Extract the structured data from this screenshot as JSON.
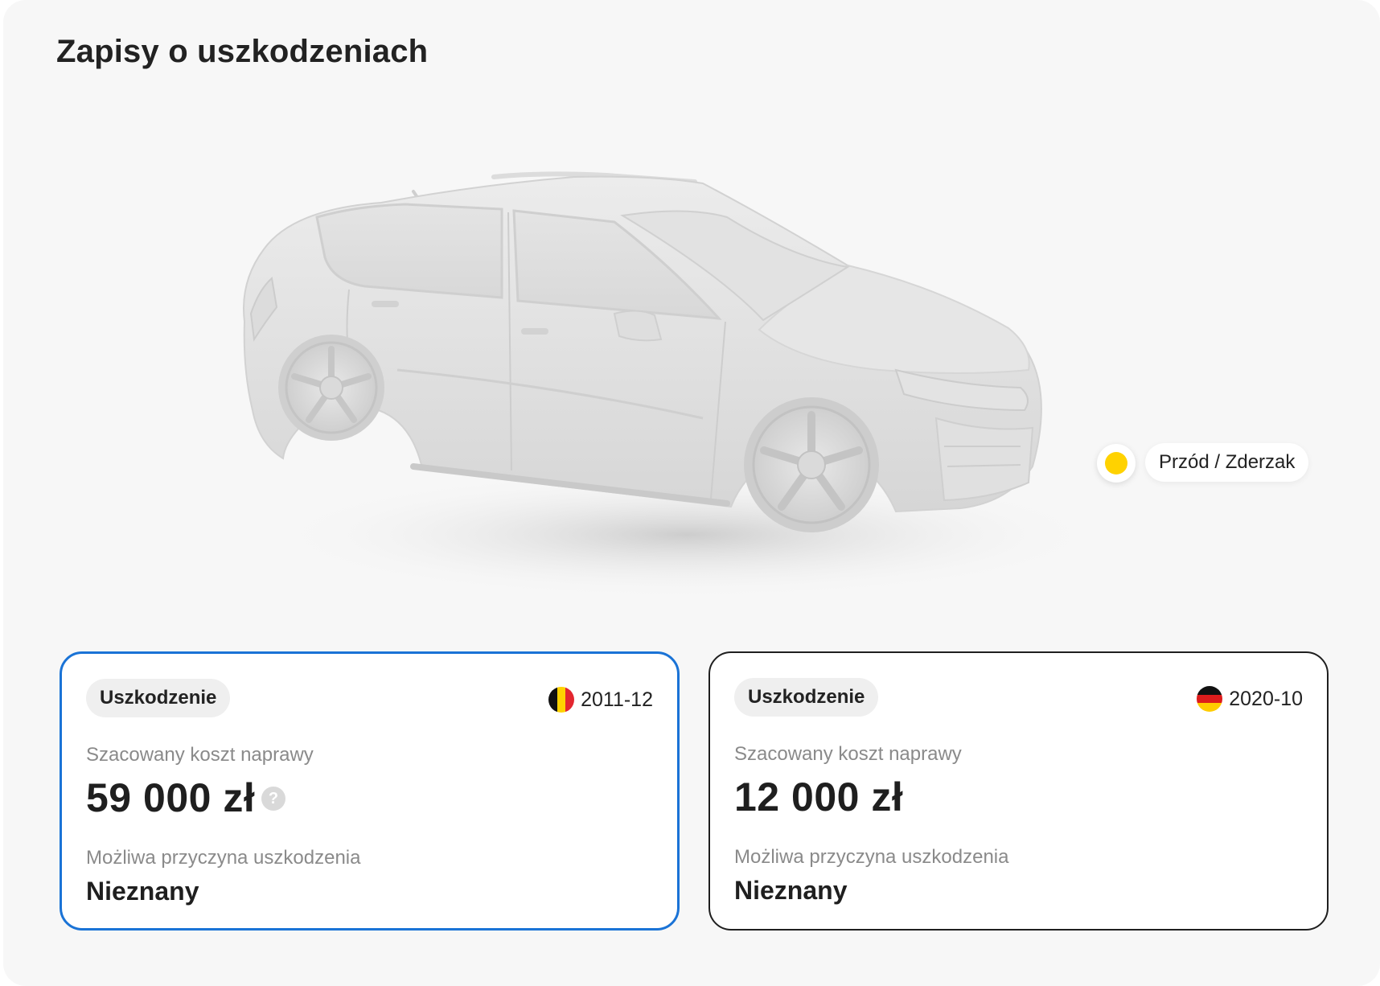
{
  "page": {
    "title": "Zapisy o uszkodzeniach"
  },
  "hotspot": {
    "label": "Przód / Zderzak",
    "color": "#ffd200"
  },
  "records": [
    {
      "badge": "Uszkodzenie",
      "flag_icon": "belgium-flag-icon",
      "date": "2011-12",
      "cost_label": "Szacowany koszt naprawy",
      "cost_value": "59 000 zł",
      "help_icon": "question-mark-icon",
      "help_symbol": "?",
      "cause_label": "Możliwa przyczyna uszkodzenia",
      "cause_value": "Nieznany",
      "selected": true
    },
    {
      "badge": "Uszkodzenie",
      "flag_icon": "germany-flag-icon",
      "date": "2020-10",
      "cost_label": "Szacowany koszt naprawy",
      "cost_value": "12 000 zł",
      "cause_label": "Możliwa przyczyna uszkodzenia",
      "cause_value": "Nieznany",
      "selected": false
    }
  ],
  "colors": {
    "selected_border": "#1a73d6",
    "card_border": "#1f1f1f",
    "badge_bg": "#efefef",
    "panel_bg": "#f7f7f7",
    "muted_text": "#8a8a8a"
  }
}
